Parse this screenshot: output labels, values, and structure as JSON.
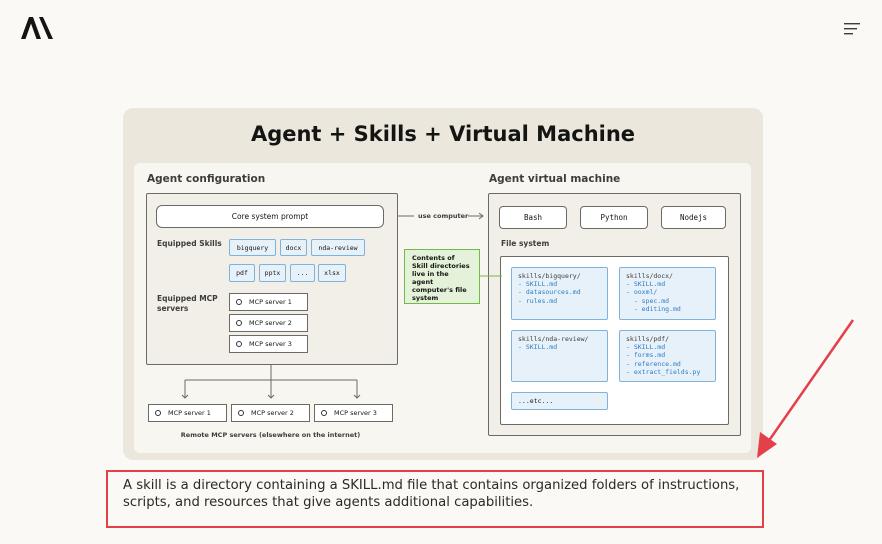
{
  "nav": {
    "logo": "Anthropic logo",
    "menu_icon": "menu-icon"
  },
  "figure": {
    "title": "Agent + Skills + Virtual Machine",
    "agent_config": {
      "heading": "Agent configuration",
      "core_prompt": "Core system prompt",
      "skills_label": "Equipped Skills",
      "skills": [
        "bigquery",
        "docx",
        "nda-review",
        "pdf",
        "pptx",
        "...",
        "xlsx"
      ],
      "mcp_label": "Equipped MCP servers",
      "mcp_servers": [
        "MCP server 1",
        "MCP server 2",
        "MCP server 3"
      ]
    },
    "use_computer": "use computer",
    "note": "Contents of Skill directories live in the agent computer's file system",
    "remote": {
      "servers": [
        "MCP server 1",
        "MCP server 2",
        "MCP server 3"
      ],
      "label": "Remote MCP servers (elsewhere on the internet)"
    },
    "vm": {
      "heading": "Agent virtual machine",
      "runtimes": [
        "Bash",
        "Python",
        "Nodejs"
      ],
      "fs_label": "File system",
      "dirs": [
        {
          "name": "skills/bigquery/",
          "files": [
            "- SKILL.md",
            "- datasources.md",
            "- rules.md"
          ]
        },
        {
          "name": "skills/docx/",
          "files": [
            "- SKILL.md",
            "- ooxml/",
            "  - spec.md",
            "  - editing.md"
          ]
        },
        {
          "name": "skills/nda-review/",
          "files": [
            "- SKILL.md"
          ]
        },
        {
          "name": "skills/pdf/",
          "files": [
            "- SKILL.md",
            "- forms.md",
            "- reference.md",
            "- extract_fields.py"
          ]
        }
      ],
      "etc": "...etc..."
    }
  },
  "caption": "A skill is a directory containing a SKILL.md file that contains organized folders of instructions, scripts, and resources that give agents additional capabilities.",
  "colors": {
    "highlight": "#e4404a",
    "skill_blue": "#2f7bc4",
    "note_green": "#74b84a"
  }
}
